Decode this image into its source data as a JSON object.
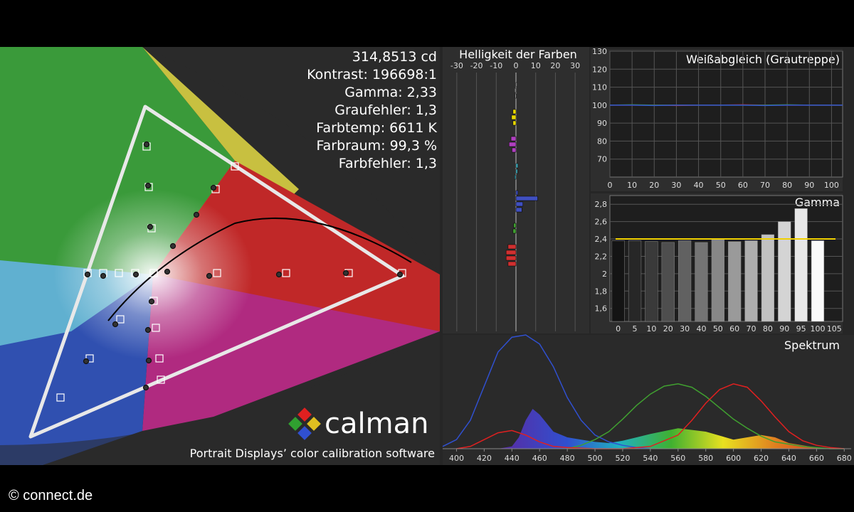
{
  "site_label": "© connect.de",
  "cie": {
    "stats": [
      "314,8513 cd",
      "Kontrast: 196698:1",
      "Gamma: 2,33",
      "Graufehler: 1,3",
      "Farbtemp: 6611 K",
      "Farbraum: 99,3 %",
      "Farbfehler: 1,3"
    ],
    "brand": "calman",
    "tagline": "Portrait Displays’ color calibration software"
  },
  "colors": {
    "panel": "#262626",
    "red": "#e02020",
    "green": "#40a030",
    "blue": "#3050d0",
    "gridline": "#555555",
    "gamma_target": "#f0d000"
  },
  "chart_data": [
    {
      "type": "bar",
      "title": "Helligkeit der Farben",
      "orientation": "horizontal",
      "xlim": [
        -35,
        35
      ],
      "x_ticks": [
        -30,
        -20,
        -10,
        0,
        10,
        20,
        30
      ],
      "groups": [
        {
          "color": "#b0b0b0",
          "values": [
            0.2,
            -0.6,
            -0.4
          ]
        },
        {
          "color": "#e8d800",
          "values": [
            -1.5,
            -2.2,
            -1.5
          ]
        },
        {
          "color": "#b040c0",
          "values": [
            -2.5,
            -3.5,
            -2.0
          ]
        },
        {
          "color": "#40b0c0",
          "values": [
            1.0,
            0.8,
            -0.6
          ]
        },
        {
          "color": "#4050c0",
          "values": [
            1.0,
            11.0,
            3.5,
            3.0
          ]
        },
        {
          "color": "#40a030",
          "values": [
            -1.2,
            -1.5
          ]
        },
        {
          "color": "#d03030",
          "values": [
            -4.0,
            -5.0,
            -5.0,
            -4.0
          ]
        }
      ]
    },
    {
      "type": "line",
      "title": "Weißabgleich (Grautreppe)",
      "x": [
        0,
        10,
        20,
        30,
        40,
        50,
        60,
        70,
        80,
        90,
        100,
        105
      ],
      "xlim": [
        0,
        105
      ],
      "ylim": [
        60,
        130
      ],
      "x_ticks": [
        0,
        10,
        20,
        30,
        40,
        50,
        60,
        70,
        80,
        90,
        100
      ],
      "y_ticks": [
        70,
        80,
        90,
        100,
        110,
        120,
        130
      ],
      "series": [
        {
          "color": "#e02020",
          "values": [
            100,
            100,
            100,
            99.8,
            100,
            100,
            100.2,
            100,
            100,
            100,
            100,
            100
          ]
        },
        {
          "color": "#40a030",
          "values": [
            100,
            100.2,
            100,
            100,
            100,
            100,
            100,
            100,
            100.2,
            100,
            100,
            100
          ]
        },
        {
          "color": "#3050d0",
          "values": [
            100,
            100,
            99.8,
            100,
            100,
            100,
            100,
            99.8,
            100,
            100,
            100,
            100
          ]
        }
      ]
    },
    {
      "type": "bar",
      "title": "Gamma",
      "categories": [
        "0",
        "5",
        "10",
        "20",
        "30",
        "40",
        "50",
        "60",
        "70",
        "80",
        "90",
        "95",
        "100",
        "105"
      ],
      "values": [
        2.38,
        2.38,
        2.37,
        2.36,
        2.38,
        2.36,
        2.4,
        2.37,
        2.38,
        2.45,
        2.6,
        2.75,
        2.38,
        null
      ],
      "target": 2.4,
      "ylim": [
        1.45,
        2.9
      ],
      "y_ticks": [
        "1,6",
        "1,8",
        "2",
        "2,2",
        "2,4",
        "2,6",
        "2,8"
      ],
      "y_tick_values": [
        1.6,
        1.8,
        2.0,
        2.2,
        2.4,
        2.6,
        2.8
      ]
    },
    {
      "type": "line",
      "title": "Spektrum",
      "xlim": [
        390,
        685
      ],
      "x_ticks": [
        400,
        420,
        440,
        460,
        480,
        500,
        520,
        540,
        560,
        580,
        600,
        620,
        640,
        660,
        680
      ],
      "series": [
        {
          "color": "#3050d0",
          "x": [
            390,
            400,
            410,
            420,
            430,
            440,
            450,
            460,
            470,
            480,
            490,
            500,
            510,
            520,
            530,
            540
          ],
          "values": [
            0.02,
            0.08,
            0.25,
            0.55,
            0.85,
            0.98,
            1.0,
            0.92,
            0.72,
            0.45,
            0.25,
            0.12,
            0.06,
            0.03,
            0.01,
            0
          ]
        },
        {
          "color": "#40a030",
          "x": [
            480,
            490,
            500,
            510,
            520,
            530,
            540,
            550,
            560,
            570,
            580,
            590,
            600,
            610,
            620,
            630,
            640,
            650,
            660,
            670,
            680
          ],
          "values": [
            0,
            0.03,
            0.08,
            0.15,
            0.26,
            0.38,
            0.48,
            0.55,
            0.57,
            0.54,
            0.46,
            0.36,
            0.26,
            0.18,
            0.11,
            0.06,
            0.04,
            0.02,
            0.01,
            0,
            0
          ]
        },
        {
          "color": "#e02020",
          "x": [
            400,
            410,
            420,
            430,
            440,
            450,
            460,
            470,
            480,
            500,
            520,
            540,
            560,
            570,
            580,
            590,
            600,
            610,
            620,
            630,
            640,
            650,
            660,
            670,
            680
          ],
          "values": [
            0,
            0.02,
            0.08,
            0.14,
            0.16,
            0.12,
            0.06,
            0.02,
            0.01,
            0,
            0,
            0.02,
            0.12,
            0.25,
            0.4,
            0.52,
            0.57,
            0.54,
            0.42,
            0.28,
            0.15,
            0.07,
            0.03,
            0.01,
            0
          ]
        },
        {
          "color": "white",
          "x": [
            430,
            440,
            445,
            450,
            455,
            460,
            470,
            480,
            490,
            500,
            510,
            520,
            540,
            560,
            580,
            600,
            610,
            620,
            630,
            640,
            660,
            680
          ],
          "values": [
            0,
            0.02,
            0.1,
            0.25,
            0.35,
            0.3,
            0.15,
            0.1,
            0.08,
            0.06,
            0.05,
            0.07,
            0.13,
            0.18,
            0.15,
            0.08,
            0.1,
            0.12,
            0.1,
            0.05,
            0.01,
            0
          ]
        }
      ]
    }
  ]
}
